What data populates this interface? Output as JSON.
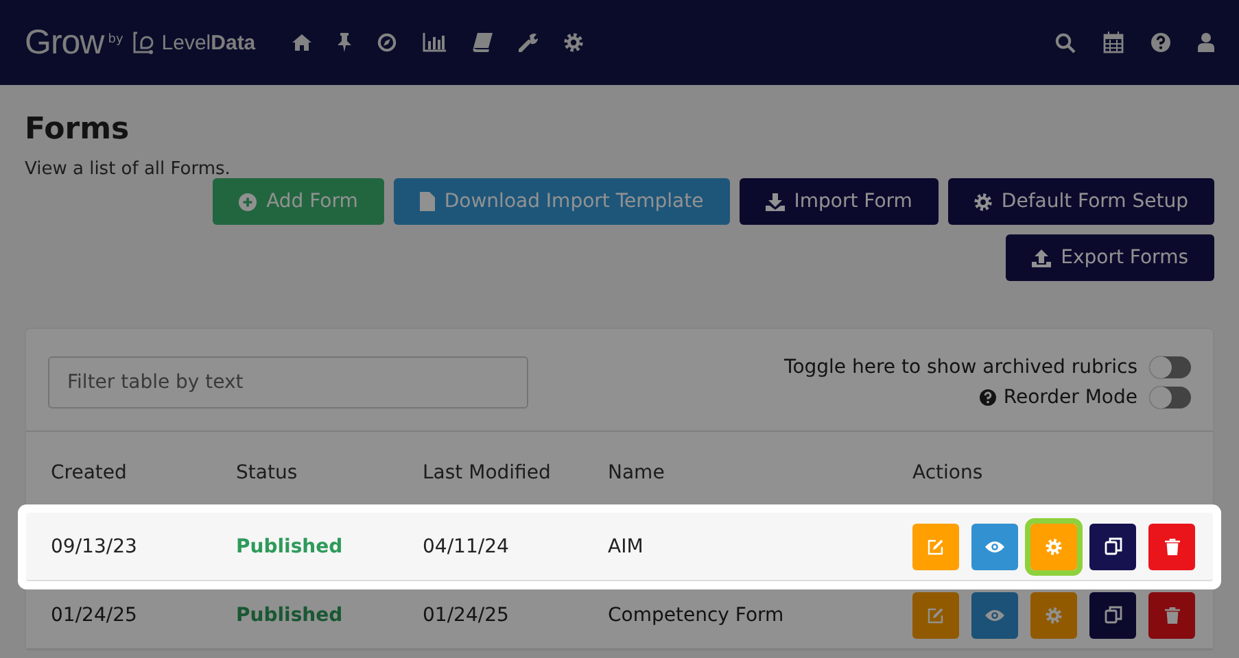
{
  "header": {
    "logo": {
      "product": "Grow",
      "by": "by",
      "brand_light": "Level",
      "brand_bold": "Data"
    }
  },
  "page": {
    "title": "Forms",
    "subtitle": "View a list of all Forms."
  },
  "buttons": [
    {
      "label": "Add Form",
      "kind": "add"
    },
    {
      "label": "Download Import Template",
      "kind": "download"
    },
    {
      "label": "Import Form",
      "kind": "import"
    },
    {
      "label": "Default Form Setup",
      "kind": "setup"
    },
    {
      "label": "Export Forms",
      "kind": "export"
    }
  ],
  "filter": {
    "placeholder": "Filter table by text"
  },
  "toggles": [
    {
      "label": "Toggle here to show archived rubrics",
      "on": false,
      "help": false
    },
    {
      "label": "Reorder Mode",
      "on": false,
      "help": true
    }
  ],
  "table": {
    "columns": [
      "Created",
      "Status",
      "Last Modified",
      "Name",
      "Actions"
    ],
    "rows": [
      {
        "created": "09/13/23",
        "status": "Published",
        "modified": "04/11/24",
        "name": "AIM",
        "highlighted": true,
        "actions": [
          {
            "kind": "edit",
            "focused": false
          },
          {
            "kind": "view",
            "focused": false
          },
          {
            "kind": "settings",
            "focused": true
          },
          {
            "kind": "copy",
            "focused": false
          },
          {
            "kind": "delete",
            "focused": false
          }
        ]
      },
      {
        "created": "01/24/25",
        "status": "Published",
        "modified": "01/24/25",
        "name": "Competency Form",
        "highlighted": false,
        "actions": [
          {
            "kind": "edit",
            "focused": false
          },
          {
            "kind": "view",
            "focused": false
          },
          {
            "kind": "settings",
            "focused": false
          },
          {
            "kind": "copy",
            "focused": false
          },
          {
            "kind": "delete",
            "focused": false
          }
        ]
      }
    ]
  }
}
